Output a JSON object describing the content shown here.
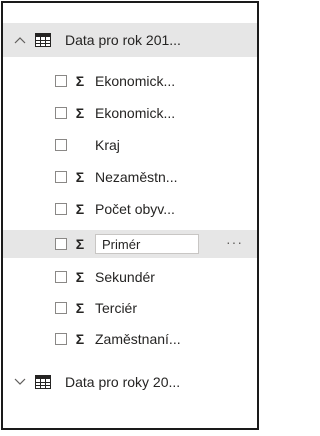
{
  "tables": [
    {
      "name": "Data pro rok 201...",
      "expanded": true,
      "fields": [
        {
          "label": "Ekonomick...",
          "aggregate": true
        },
        {
          "label": "Ekonomick...",
          "aggregate": true
        },
        {
          "label": "Kraj",
          "aggregate": false
        },
        {
          "label": "Nezaměstn...",
          "aggregate": true
        },
        {
          "label": "Počet obyv...",
          "aggregate": true
        },
        {
          "label": "Primér",
          "aggregate": true,
          "editing": true
        },
        {
          "label": "Sekundér",
          "aggregate": true
        },
        {
          "label": "Terciér",
          "aggregate": true
        },
        {
          "label": "Zaměstnaní...",
          "aggregate": true
        }
      ]
    },
    {
      "name": "Data pro roky 20...",
      "expanded": false
    }
  ],
  "icons": {
    "expand": "chevron-up-icon",
    "collapse": "chevron-down-icon",
    "table": "table-icon",
    "aggregate": "sigma-icon",
    "more": "more-options-icon"
  },
  "more_options_label": "···",
  "sigma_glyph": "Σ",
  "colors": {
    "selected_row": "#e6e6e6",
    "text": "#252423",
    "border": "#1a1a1a"
  }
}
